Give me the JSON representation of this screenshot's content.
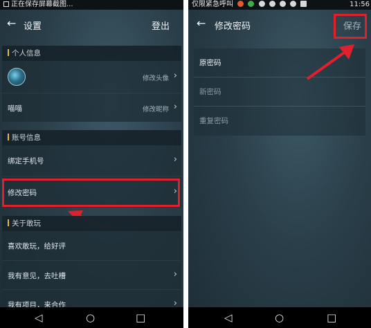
{
  "left_screen": {
    "statusbar": {
      "text": "正在保存屏幕截图..."
    },
    "appbar": {
      "title": "设置",
      "action": "登出"
    },
    "personal": {
      "header": "个人信息",
      "avatar_row": {
        "value": "修改头像"
      },
      "nickname_row": {
        "label": "喵喵",
        "value": "修改昵称"
      }
    },
    "account": {
      "header": "账号信息",
      "rows": [
        {
          "label": "绑定手机号"
        },
        {
          "label": "修改密码"
        }
      ]
    },
    "about": {
      "header": "关于敢玩",
      "rows": [
        {
          "label": "喜欢敢玩，给好评"
        },
        {
          "label": "我有意见，去吐槽"
        },
        {
          "label": "我有项目，来合作"
        }
      ]
    }
  },
  "right_screen": {
    "statusbar": {
      "text": "仅限紧急呼叫",
      "time": "11:56"
    },
    "appbar": {
      "title": "修改密码",
      "action": "保存"
    },
    "fields": {
      "old_password": "原密码",
      "new_password": "新密码",
      "repeat_password": "重复密码"
    }
  },
  "colors": {
    "highlight": "#e0202c",
    "accent": "#e8b84a"
  }
}
